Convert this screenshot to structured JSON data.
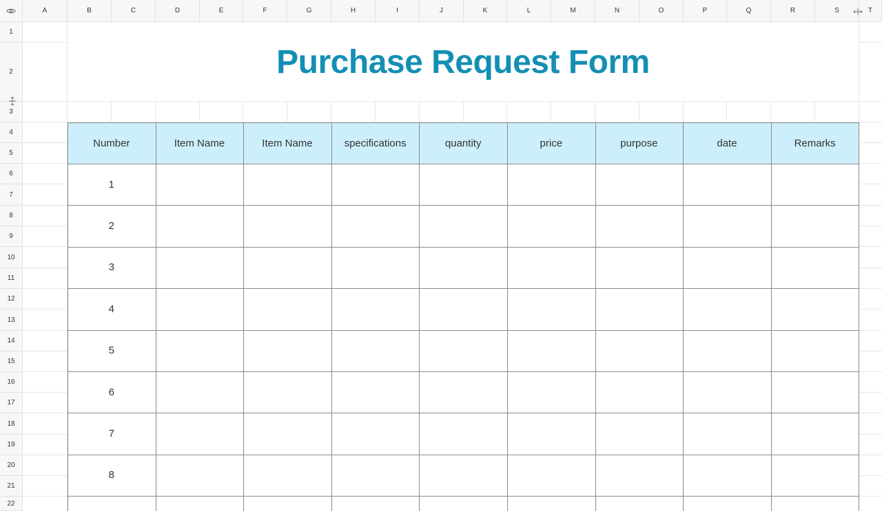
{
  "columns": [
    "A",
    "B",
    "C",
    "D",
    "E",
    "F",
    "G",
    "H",
    "I",
    "J",
    "K",
    "L",
    "M",
    "N",
    "O",
    "P",
    "Q",
    "R",
    "S",
    "T"
  ],
  "rows": [
    "1",
    "2",
    "3",
    "4",
    "5",
    "6",
    "7",
    "8",
    "9",
    "10",
    "11",
    "12",
    "13",
    "14",
    "15",
    "16",
    "17",
    "18",
    "19",
    "20",
    "21",
    "22"
  ],
  "title": "Purchase Request Form",
  "table": {
    "headers": [
      "Number",
      "Item Name",
      "Item Name",
      "specifications",
      "quantity",
      "price",
      "purpose",
      "date",
      "Remarks"
    ],
    "row_numbers": [
      "1",
      "2",
      "3",
      "4",
      "5",
      "6",
      "7",
      "8"
    ]
  },
  "colors": {
    "title": "#138fb4",
    "header_fill": "#cdeffc",
    "table_border": "#8a8a8a"
  },
  "icons": {
    "corner": "eye-icon",
    "row_resize": "resize-vertical-icon",
    "col_resize": "resize-horizontal-icon"
  }
}
